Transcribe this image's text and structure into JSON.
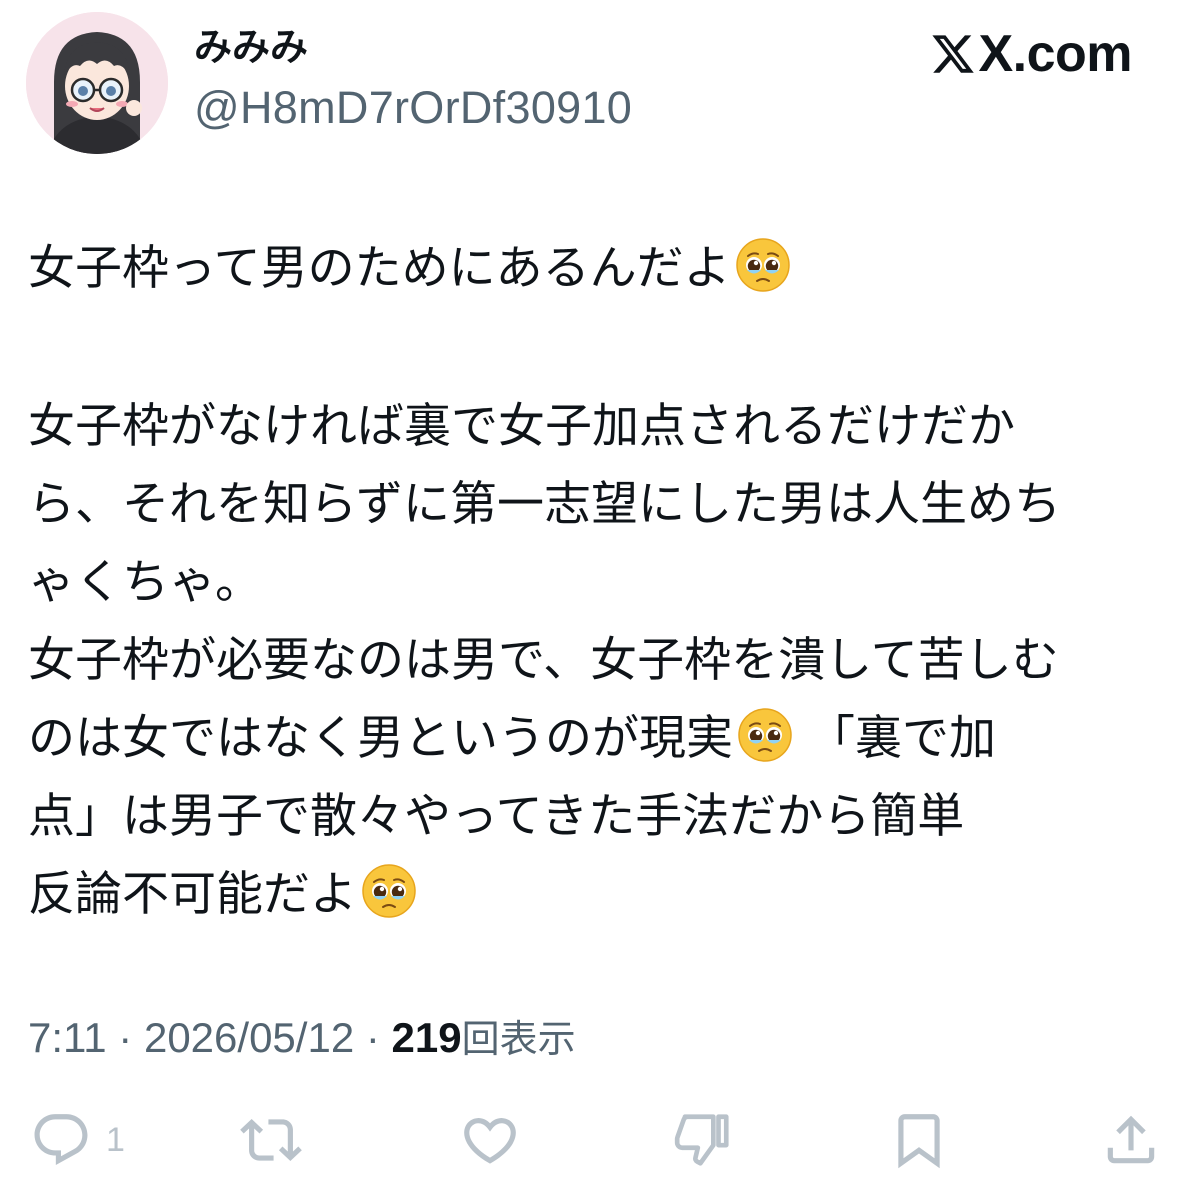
{
  "author": {
    "display_name": "みみみ",
    "handle": "@H8mD7rOrDf30910",
    "avatar_icon": "avatar-girl-glasses-illustration"
  },
  "source": {
    "logo_icon": "x-logo-icon",
    "label": "X.com"
  },
  "tweet": {
    "lines": [
      {
        "text": "女子枠って男のためにあるんだよ",
        "emoji": "pleading-face-emoji"
      },
      {
        "text": "",
        "blank": true
      },
      {
        "text": "女子枠がなければ裏で女子加点されるだけだか"
      },
      {
        "text": "ら、それを知らずに第一志望にした男は人生めち"
      },
      {
        "text": "ゃくちゃ。"
      },
      {
        "text": "女子枠が必要なのは男で、女子枠を潰して苦しむ"
      },
      {
        "text_before": "のは女ではなく男というのが現実",
        "emoji": "pleading-face-emoji",
        "text_after": " 「裏で加"
      },
      {
        "text": "点」は男子で散々やってきた手法だから簡単"
      },
      {
        "text": "反論不可能だよ",
        "emoji": "pleading-face-emoji"
      }
    ]
  },
  "meta": {
    "time": "7:11",
    "separator": " · ",
    "date": "2026/05/12",
    "views_count": "219",
    "views_label": "回表示"
  },
  "actions": {
    "reply": {
      "icon": "reply-icon",
      "count": "1"
    },
    "repost": {
      "icon": "repost-icon"
    },
    "like": {
      "icon": "heart-icon"
    },
    "bookmark_dislike": {
      "icon": "thumbs-down-icon"
    },
    "bookmark": {
      "icon": "bookmark-icon"
    },
    "share": {
      "icon": "share-icon"
    }
  },
  "colors": {
    "text": "#0f1419",
    "secondary": "#536471",
    "icon_faint": "#b9c2ca",
    "background": "#ffffff"
  }
}
